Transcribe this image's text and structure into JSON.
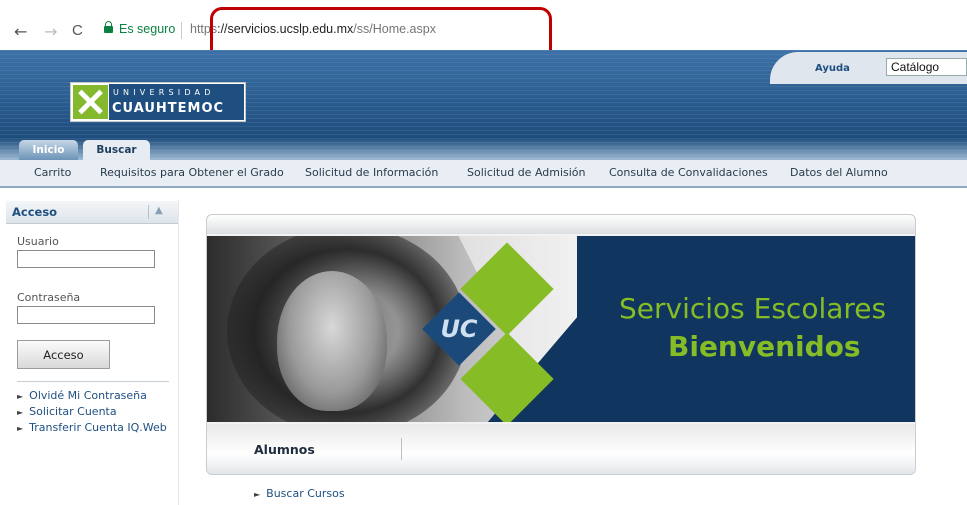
{
  "browser": {
    "back_icon": "←",
    "forward_icon": "→",
    "reload_icon": "C",
    "secure_label": "Es seguro",
    "url_scheme_partial": "https",
    "url_host": "://servicios.ucslp.edu.mx",
    "url_path": "/ss/Home.aspx",
    "highlight_color": "#c00000"
  },
  "header": {
    "help_label": "Ayuda",
    "catalog_value": "Catálogo",
    "logo": {
      "top_text": "UNIVERSIDAD",
      "main_text": "CUAUHTEMOC"
    },
    "tabs": [
      {
        "label": "Inicio",
        "active": true
      },
      {
        "label": "Buscar",
        "active": false
      }
    ]
  },
  "menu": [
    "Carrito",
    "Requisitos para Obtener el Grado",
    "Solicitud de Información",
    "Solicitud de Admisión",
    "Consulta de Convalidaciones",
    "Datos del Alumno"
  ],
  "sidebar": {
    "title": "Acceso",
    "collapse_icon": "▲",
    "username_label": "Usuario",
    "username_value": "",
    "password_label": "Contraseña",
    "password_value": "",
    "login_button": "Acceso",
    "links": [
      "Olvidé Mi Contraseña",
      "Solicitar Cuenta",
      "Transferir Cuenta IQ.Web"
    ]
  },
  "banner": {
    "line1": "Servicios Escolares",
    "line2": "Bienvenidos",
    "accent_color": "#86bc25",
    "background_color": "#10355e"
  },
  "section": {
    "title": "Alumnos",
    "link": "Buscar Cursos"
  },
  "colors": {
    "brand_blue": "#1f4f80",
    "header_blue": "#2b5f92"
  }
}
